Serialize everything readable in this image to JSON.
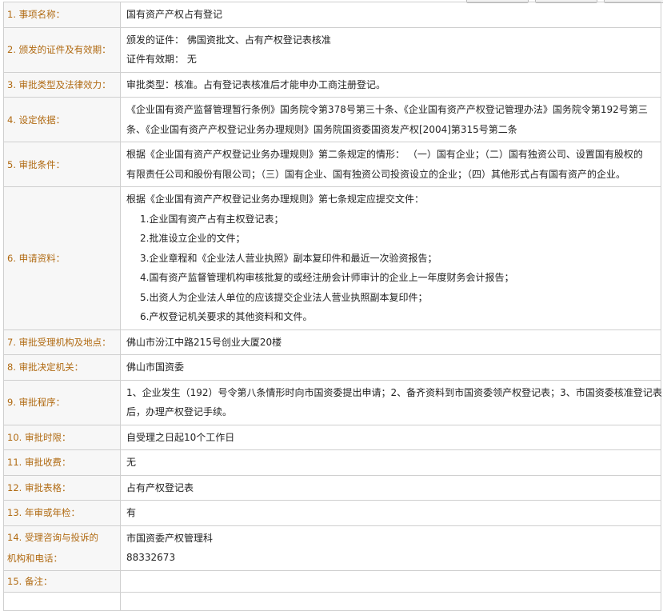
{
  "rows": [
    {
      "label": "1. 事项名称：",
      "value": [
        "国有资产产权占有登记"
      ]
    },
    {
      "label": "2. 颁发的证件及有效期：",
      "value": [
        "颁发的证件：  佛国资批文、占有产权登记表核准",
        "证件有效期：  无"
      ]
    },
    {
      "label": "3. 审批类型及法律效力：",
      "value": [
        "审批类型：核准。占有登记表核准后才能申办工商注册登记。"
      ]
    },
    {
      "label": "4. 设定依据：",
      "value": [
        "《企业国有资产监督管理暂行条例》国务院令第378号第三十条、《企业国有资产产权登记管理办法》国务院令第192号第三",
        "条、《企业国有资产产权登记业务办理规则》国务院国资委国资发产权[2004]第315号第二条"
      ]
    },
    {
      "label": "5. 审批条件：",
      "value": [
        "根据《企业国有资产产权登记业务办理规则》第二条规定的情形：  （一）国有企业；（二）国有独资公司、设置国有股权的",
        "有限责任公司和股份有限公司；（三）国有企业、国有独资公司投资设立的企业；（四）其他形式占有国有资产的企业。"
      ]
    },
    {
      "label": "6. 申请资料：",
      "intro": "根据《企业国有资产产权登记业务办理规则》第七条规定应提交文件：",
      "items": [
        "1.企业国有资产占有主权登记表；",
        "2.批准设立企业的文件；",
        "3.企业章程和《企业法人营业执照》副本复印件和最近一次验资报告；",
        "4.国有资产监督管理机构审核批复的或经注册会计师审计的企业上一年度财务会计报告；",
        "5.出资人为企业法人单位的应该提交企业法人营业执照副本复印件；",
        "6.产权登记机关要求的其他资料和文件。"
      ]
    },
    {
      "label": "7. 审批受理机构及地点：",
      "value": [
        "佛山市汾江中路215号创业大厦20楼"
      ]
    },
    {
      "label": "8. 审批决定机关：",
      "value": [
        "佛山市国资委"
      ]
    },
    {
      "label": "9. 审批程序：",
      "value": [
        "1、企业发生（192）号令第八条情形时向市国资委提出申请；2、备齐资料到市国资委领产权登记表；3、市国资委核准登记表",
        "后，办理产权登记手续。"
      ]
    },
    {
      "label": "10. 审批时限：",
      "value": [
        "自受理之日起10个工作日"
      ]
    },
    {
      "label": "11. 审批收费：",
      "value": [
        "无"
      ]
    },
    {
      "label": "12. 审批表格：",
      "value": [
        "占有产权登记表"
      ]
    },
    {
      "label": "13. 年审或年检：",
      "value": [
        "有"
      ]
    },
    {
      "label": "14. 受理咨询与投诉的机构和电话：",
      "label_lines": [
        "14. 受理咨询与投诉的",
        "机构和电话："
      ],
      "value": [
        "市国资委产权管理科",
        "88332673"
      ]
    },
    {
      "label": "15. 备注：",
      "value": []
    }
  ]
}
